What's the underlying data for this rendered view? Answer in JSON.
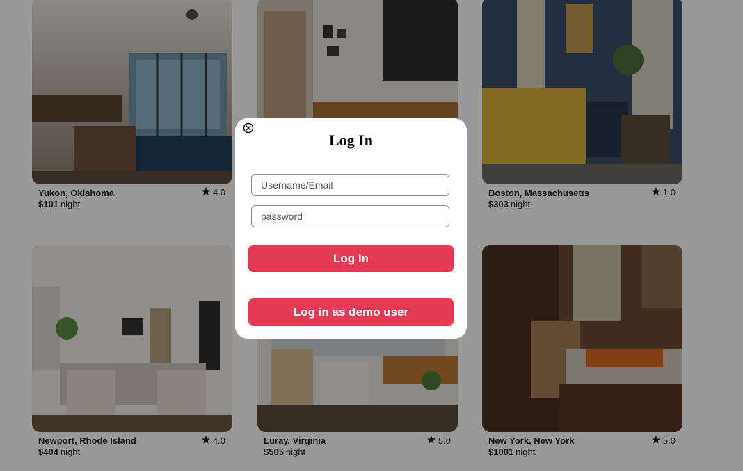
{
  "colors": {
    "accent": "#e33a56",
    "overlay": "rgba(0,0,0,0.4)"
  },
  "listings": [
    {
      "location": "Yukon, Oklahoma",
      "price": "$101",
      "unit": "night",
      "rating": "4.0",
      "photo": "living-room-with-lake-view"
    },
    {
      "location": "",
      "price": "",
      "unit": "",
      "rating": "",
      "photo": "living-room-with-gallery-wall"
    },
    {
      "location": "Boston, Massachusetts",
      "price": "$303",
      "unit": "night",
      "rating": "1.0",
      "photo": "blue-living-room-with-yellow-sofa"
    },
    {
      "location": "Newport, Rhode Island",
      "price": "$404",
      "unit": "night",
      "rating": "4.0",
      "photo": "white-living-room-with-armchairs"
    },
    {
      "location": "Luray, Virginia",
      "price": "$505",
      "unit": "night",
      "rating": "5.0",
      "photo": "modern-living-room-with-lounge-chair"
    },
    {
      "location": "New York, New York",
      "price": "$1001",
      "unit": "night",
      "rating": "5.0",
      "photo": "small-bedroom-with-desk"
    }
  ],
  "modal": {
    "title": "Log In",
    "username_placeholder": "Username/Email",
    "password_placeholder": "password",
    "login_label": "Log In",
    "demo_label": "Log in as demo user",
    "close_icon": "close-circle-icon"
  }
}
